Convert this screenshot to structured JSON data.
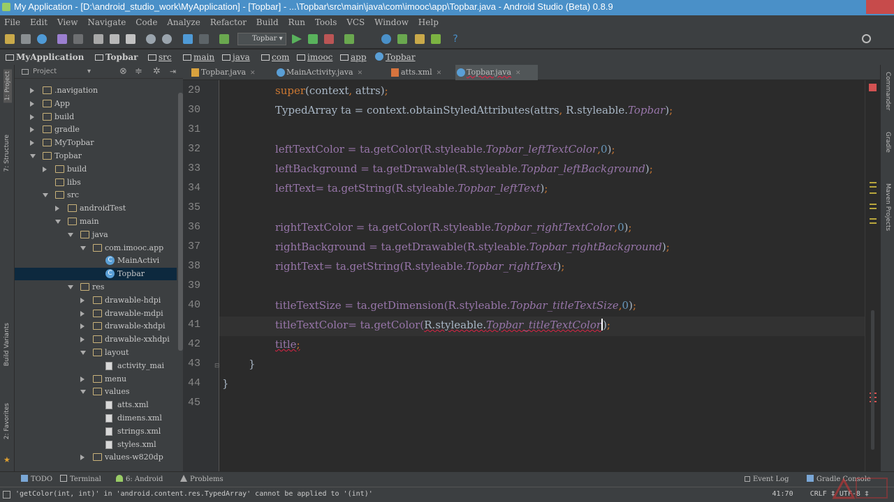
{
  "window": {
    "title": "My Application - [D:\\android_studio_work\\MyApplication] - [Topbar] - ...\\Topbar\\src\\main\\java\\com\\imooc\\app\\Topbar.java - Android Studio (Beta) 0.8.9"
  },
  "menu": [
    "File",
    "Edit",
    "View",
    "Navigate",
    "Code",
    "Analyze",
    "Refactor",
    "Build",
    "Run",
    "Tools",
    "VCS",
    "Window",
    "Help"
  ],
  "toolbar": {
    "run_config": "Topbar"
  },
  "breadcrumb": [
    "MyApplication",
    "Topbar",
    "src",
    "main",
    "java",
    "com",
    "imooc",
    "app",
    "Topbar"
  ],
  "project_panel": {
    "header": "Project",
    "tree": [
      {
        "label": ".navigation",
        "depth": 1,
        "type": "folder",
        "state": "collapsed"
      },
      {
        "label": "App",
        "depth": 1,
        "type": "folder",
        "state": "collapsed"
      },
      {
        "label": "build",
        "depth": 1,
        "type": "folder",
        "state": "collapsed"
      },
      {
        "label": "gradle",
        "depth": 1,
        "type": "folder",
        "state": "collapsed"
      },
      {
        "label": "MyTopbar",
        "depth": 1,
        "type": "folder",
        "state": "collapsed"
      },
      {
        "label": "Topbar",
        "depth": 1,
        "type": "folder",
        "state": "expanded"
      },
      {
        "label": "build",
        "depth": 2,
        "type": "folder",
        "state": "collapsed"
      },
      {
        "label": "libs",
        "depth": 2,
        "type": "folder",
        "state": "leaf"
      },
      {
        "label": "src",
        "depth": 2,
        "type": "folder",
        "state": "expanded"
      },
      {
        "label": "androidTest",
        "depth": 3,
        "type": "folder",
        "state": "collapsed"
      },
      {
        "label": "main",
        "depth": 3,
        "type": "folder",
        "state": "expanded"
      },
      {
        "label": "java",
        "depth": 4,
        "type": "folder",
        "state": "expanded"
      },
      {
        "label": "com.imooc.app",
        "depth": 5,
        "type": "folder",
        "state": "expanded"
      },
      {
        "label": "MainActivi",
        "depth": 6,
        "type": "class",
        "state": "leaf"
      },
      {
        "label": "Topbar",
        "depth": 6,
        "type": "class",
        "state": "selected"
      },
      {
        "label": "res",
        "depth": 4,
        "type": "folder",
        "state": "expanded"
      },
      {
        "label": "drawable-hdpi",
        "depth": 5,
        "type": "folder",
        "state": "collapsed"
      },
      {
        "label": "drawable-mdpi",
        "depth": 5,
        "type": "folder",
        "state": "collapsed"
      },
      {
        "label": "drawable-xhdpi",
        "depth": 5,
        "type": "folder",
        "state": "collapsed"
      },
      {
        "label": "drawable-xxhdpi",
        "depth": 5,
        "type": "folder",
        "state": "collapsed"
      },
      {
        "label": "layout",
        "depth": 5,
        "type": "folder",
        "state": "expanded"
      },
      {
        "label": "activity_mai",
        "depth": 6,
        "type": "xml",
        "state": "leaf"
      },
      {
        "label": "menu",
        "depth": 5,
        "type": "folder",
        "state": "collapsed"
      },
      {
        "label": "values",
        "depth": 5,
        "type": "folder",
        "state": "expanded"
      },
      {
        "label": "atts.xml",
        "depth": 6,
        "type": "xml",
        "state": "leaf"
      },
      {
        "label": "dimens.xml",
        "depth": 6,
        "type": "xml",
        "state": "leaf"
      },
      {
        "label": "strings.xml",
        "depth": 6,
        "type": "xml",
        "state": "leaf"
      },
      {
        "label": "styles.xml",
        "depth": 6,
        "type": "xml",
        "state": "leaf"
      },
      {
        "label": "values-w820dp",
        "depth": 5,
        "type": "folder",
        "state": "collapsed"
      }
    ]
  },
  "tabs": [
    {
      "label": "Topbar.java",
      "icon": "java",
      "active": false
    },
    {
      "label": "MainActivity.java",
      "icon": "class",
      "active": false
    },
    {
      "label": "atts.xml",
      "icon": "xml",
      "active": false
    },
    {
      "label": "Topbar.java",
      "icon": "class",
      "active": true
    }
  ],
  "editor": {
    "line_numbers": [
      "29",
      "30",
      "31",
      "32",
      "33",
      "34",
      "35",
      "36",
      "37",
      "38",
      "39",
      "40",
      "41",
      "42",
      "43",
      "44",
      "45"
    ],
    "lines": {
      "l29a": "super",
      "l29b": "(context",
      "l29c": ",",
      "l29d": " attrs)",
      "l29e": ";",
      "l30a": "TypedArray ta = context.obtainStyledAttributes(attrs",
      "l30b": ",",
      "l30c": " R.styleable.",
      "l30d": "Topbar",
      "l30e": ")",
      "l30f": ";",
      "l32a": "leftTextColor = ta.getColor(R.styleable.",
      "l32b": "Topbar_leftTextColor",
      "l32c": ",",
      "l32d": "0",
      "l32e": ")",
      "l32f": ";",
      "l33a": "leftBackground = ta.getDrawable(R.styleable.",
      "l33b": "Topbar_leftBackground",
      "l33c": ")",
      "l33d": ";",
      "l34a": "leftText= ta.getString(R.styleable.",
      "l34b": "Topbar_leftText",
      "l34c": ")",
      "l34d": ";",
      "l36a": "rightTextColor = ta.getColor(R.styleable.",
      "l36b": "Topbar_rightTextColor",
      "l36c": ",",
      "l36d": "0",
      "l36e": ")",
      "l36f": ";",
      "l37a": "rightBackground = ta.getDrawable(R.styleable.",
      "l37b": "Topbar_rightBackground",
      "l37c": ")",
      "l37d": ";",
      "l38a": "rightText= ta.getString(R.styleable.",
      "l38b": "Topbar_rightText",
      "l38c": ")",
      "l38d": ";",
      "l40a": "titleTextSize = ta.getDimension(R.styleable.",
      "l40b": "Topbar_titleTextSize",
      "l40c": ",",
      "l40d": "0",
      "l40e": ")",
      "l40f": ";",
      "l41a": "titleTextColor= ta.getColor(",
      "l41b": "R.styleable.",
      "l41c": "Topbar_titleTextColor",
      "l41d": ")",
      "l41e": ";",
      "l42a": "title",
      "l42b": ";",
      "l43a": "}",
      "l44a": "}"
    }
  },
  "bottom_tools": [
    "TODO",
    "Terminal",
    "6: Android",
    "Problems",
    "Event Log",
    "Gradle Console"
  ],
  "left_tools": [
    "1: Project",
    "7: Structure",
    "Build Variants",
    "2: Favorites"
  ],
  "right_tools": [
    "Commander",
    "Gradle",
    "Maven Projects"
  ],
  "status": {
    "message": "'getColor(int, int)' in 'android.content.res.TypedArray' cannot be applied to '(int)'",
    "position": "41:70",
    "line_sep": "CRLF",
    "encoding": "UTF-8"
  },
  "colors": {
    "keyword": "#cc7832",
    "field": "#9876aa",
    "number": "#6897bb",
    "text": "#a9b7c6",
    "bg": "#2b2b2b"
  }
}
